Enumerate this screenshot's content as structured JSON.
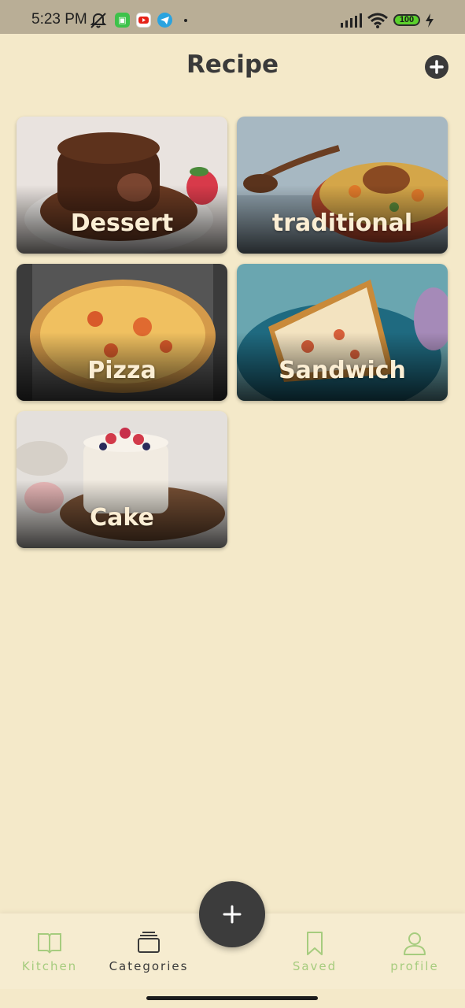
{
  "status_bar": {
    "time": "5:23 PM",
    "battery": "100",
    "icons": [
      "mute-icon",
      "android-icon",
      "youtube-icon",
      "telegram-icon",
      "signal-icon",
      "wifi-icon",
      "battery-icon",
      "charging-icon"
    ]
  },
  "header": {
    "title": "Recipe",
    "add_icon": "plus-circle-icon"
  },
  "categories": [
    {
      "name": "Dessert"
    },
    {
      "name": "traditional"
    },
    {
      "name": "Pizza"
    },
    {
      "name": "Sandwich"
    },
    {
      "name": "Cake"
    }
  ],
  "bottom_nav": {
    "items": [
      {
        "label": "Kitchen",
        "icon": "book-icon",
        "active": false
      },
      {
        "label": "Categories",
        "icon": "stack-icon",
        "active": true
      },
      {
        "label": "Saved",
        "icon": "bookmark-icon",
        "active": false
      },
      {
        "label": "profile",
        "icon": "user-icon",
        "active": false
      }
    ],
    "fab_icon": "plus-icon"
  },
  "colors": {
    "background": "#f4e9c9",
    "accent_green": "#a6cc7e",
    "dark": "#3a3a3a",
    "label_text": "#fbeed4"
  }
}
